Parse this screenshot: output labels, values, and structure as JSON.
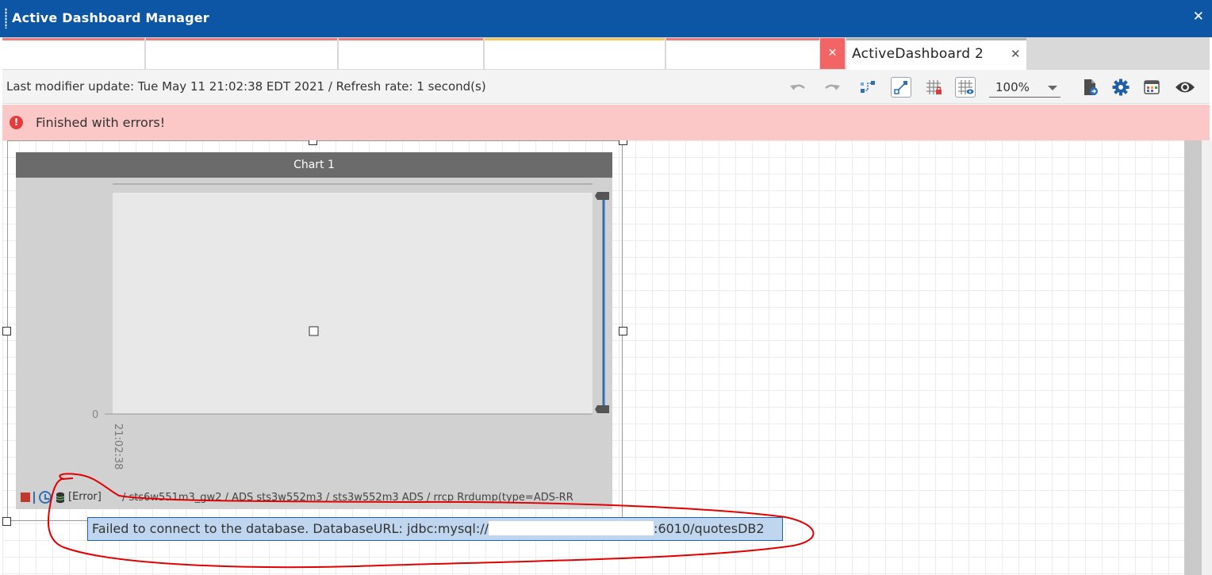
{
  "window": {
    "title": "Active Dashboard Manager",
    "close_glyph": "✕"
  },
  "tabs": {
    "closed_tab_glyph": "✕",
    "active": {
      "label": "ActiveDashboard 2",
      "close_glyph": "✕"
    }
  },
  "status": {
    "text": "Last modifier update: Tue May 11 21:02:38 EDT 2021 / Refresh rate: 1 second(s)",
    "zoom": "100%"
  },
  "toolbar": {
    "icons": [
      "undo-icon",
      "redo-icon",
      "connect-nodes-icon",
      "link-icon",
      "grid-lock-icon",
      "grid-view-icon",
      "zoom-select",
      "export-icon",
      "settings-icon",
      "layout-icon",
      "preview-icon"
    ]
  },
  "banner": {
    "icon": "!",
    "text": "Finished with errors!",
    "color": "#fcc7c7"
  },
  "chart": {
    "header": "Chart 1",
    "footer_error": "[Error]",
    "footer_path": "/ sts6w551m3_gw2 / ADS sts3w552m3 / sts3w552m3  ADS / rrcp Rrdump(type=ADS-RR"
  },
  "chart_data": {
    "type": "line",
    "title": "Chart 1",
    "x": [
      "21:02:38"
    ],
    "y_ticks": [
      0
    ],
    "series": [],
    "grid": false
  },
  "tooltip": {
    "before": "Failed to connect to the database. DatabaseURL: jdbc:mysql://",
    "after": ":6010/quotesDB2"
  },
  "colors": {
    "titlebar": "#0d55a5",
    "accent_blue": "#1e61b0",
    "error_red": "#e53b3b",
    "annotation": "#e00000"
  }
}
